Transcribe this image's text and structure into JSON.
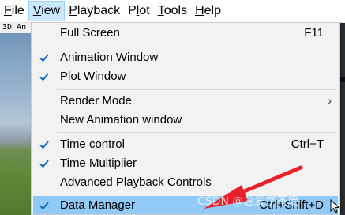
{
  "menubar": {
    "items": [
      {
        "label": "File",
        "accel": "F",
        "rest": "ile"
      },
      {
        "label": "View",
        "accel": "V",
        "rest": "iew"
      },
      {
        "label": "Playback",
        "accel": "P",
        "rest": "layback"
      },
      {
        "label": "Plot",
        "pre": "P",
        "accel": "l",
        "rest": "ot"
      },
      {
        "label": "Tools",
        "accel": "T",
        "rest": "ools"
      },
      {
        "label": "Help",
        "accel": "H",
        "rest": "elp"
      }
    ],
    "active": "View"
  },
  "background": {
    "pane_title": "3D An"
  },
  "view_menu": {
    "items": [
      {
        "label": "Full Screen",
        "shortcut": "F11",
        "checked": false
      },
      {
        "label": "Animation Window",
        "checked": true
      },
      {
        "label": "Plot Window",
        "checked": true
      },
      {
        "label": "Render Mode",
        "submenu": true,
        "checked": false
      },
      {
        "label": "New Animation window",
        "checked": false
      },
      {
        "label": "Time control",
        "shortcut": "Ctrl+T",
        "checked": true
      },
      {
        "label": "Time Multiplier",
        "checked": true
      },
      {
        "label": "Advanced Playback Controls",
        "checked": false
      },
      {
        "label": "Data Manager",
        "shortcut": "Ctrl+Shift+D",
        "checked": true,
        "highlighted": true
      }
    ]
  },
  "watermark": "CSDN @总爱学不废",
  "colors": {
    "menu_bg": "#f2f2f2",
    "active_menu": "#cce8ff",
    "check": "#0067c0",
    "highlight": "#91c9f7",
    "arrow": "#e8202a"
  }
}
